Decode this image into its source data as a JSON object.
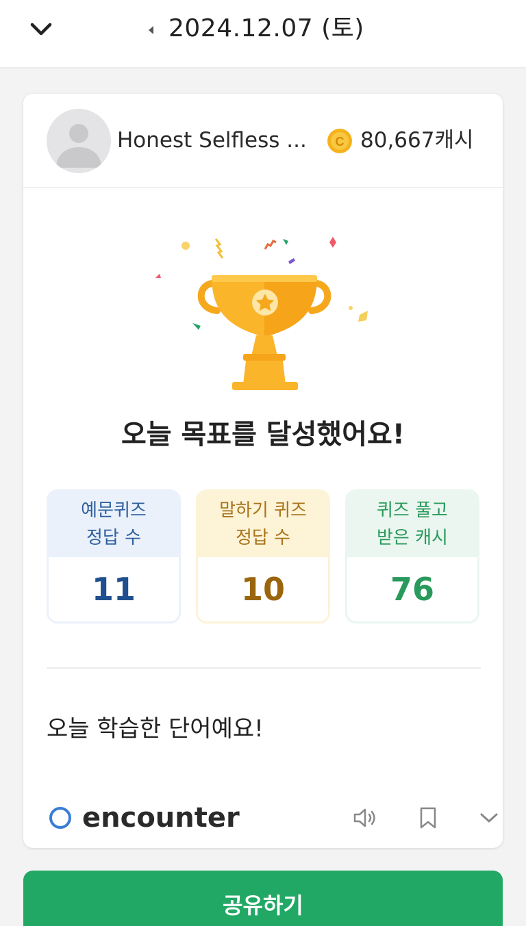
{
  "topbar": {
    "back_icon": "chevron-down-icon",
    "prev_icon": "caret-left-icon",
    "date": "2024.12.07 (토)"
  },
  "profile": {
    "avatar_icon": "user-silhouette-icon",
    "name": "Honest Selfless ...",
    "coin_icon": "coin-icon",
    "coin_symbol": "C",
    "cash": "80,667캐시"
  },
  "achievement": {
    "illustration": "trophy-icon",
    "title": "오늘 목표를 달성했어요!"
  },
  "stats": [
    {
      "label_line1": "예문퀴즈",
      "label_line2": "정답 수",
      "value": "11",
      "color": "#1f4f8e"
    },
    {
      "label_line1": "말하기 퀴즈",
      "label_line2": "정답 수",
      "value": "10",
      "color": "#9a650c"
    },
    {
      "label_line1": "퀴즈 풀고",
      "label_line2": "받은 캐시",
      "value": "76",
      "color": "#2a9a5c"
    }
  ],
  "words": {
    "title": "오늘 학습한 단어예요!",
    "items": [
      {
        "word": "encounter",
        "status_icon": "circle-icon",
        "actions": [
          "speaker-icon",
          "bookmark-icon",
          "chevron-down-icon"
        ]
      }
    ]
  },
  "share": {
    "label": "공유하기",
    "color": "#22a865"
  }
}
